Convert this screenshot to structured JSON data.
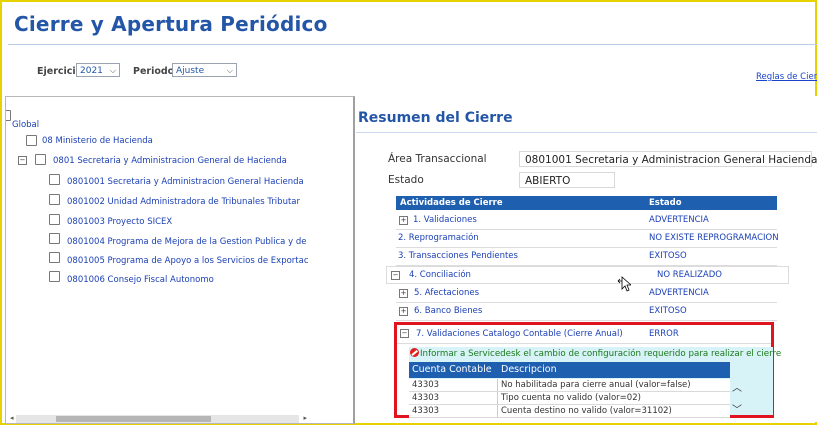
{
  "page": {
    "title": "Cierre y Apertura Periódico"
  },
  "filters": {
    "ejercicio_label": "Ejercicio:",
    "ejercicio_value": "2021",
    "periodo_label": "Periodo:",
    "periodo_value": "Ajuste",
    "reglas_link": "Reglas de Cierre"
  },
  "tree": {
    "root": "Global",
    "items": [
      {
        "label": "08 Ministerio de Hacienda"
      },
      {
        "label": "0801 Secretaria y Administracion General de Hacienda"
      },
      {
        "label": "0801001 Secretaria y Administracion General Hacienda"
      },
      {
        "label": "0801002 Unidad Administradora de Tribunales Tributar"
      },
      {
        "label": "0801003 Proyecto SICEX"
      },
      {
        "label": "0801004 Programa de Mejora de la Gestion Publica y de"
      },
      {
        "label": "0801005 Programa de Apoyo a los Servicios de Exportac"
      },
      {
        "label": "0801006 Consejo Fiscal Autonomo"
      }
    ]
  },
  "summary": {
    "title": "Resumen del Cierre",
    "area_label": "Área Transaccional",
    "area_value": "0801001 Secretaria y Administracion General Hacienda",
    "estado_label": "Estado",
    "estado_value": "ABIERTO"
  },
  "activities": {
    "col_activity": "Actividades de Cierre",
    "col_status": "Estado",
    "rows": [
      {
        "name": "1. Validaciones",
        "status": "ADVERTENCIA"
      },
      {
        "name": "2. Reprogramación",
        "status": "NO EXISTE REPROGRAMACION"
      },
      {
        "name": "3. Transacciones Pendientes",
        "status": "EXITOSO"
      },
      {
        "name": "4. Conciliación",
        "status": "NO REALIZADO"
      },
      {
        "name": "5. Afectaciones",
        "status": "ADVERTENCIA"
      },
      {
        "name": "6. Banco Bienes",
        "status": "EXITOSO"
      },
      {
        "name": "7. Validaciones Catalogo Contable (Cierre Anual)",
        "status": "ERROR"
      }
    ]
  },
  "detail": {
    "message": "Informar a Servicedesk el cambio de configuración requerido para realizar el cierre",
    "col_cuenta": "Cuenta Contable",
    "col_descripcion": "Descripcion",
    "rows": [
      {
        "cuenta": "43303",
        "descripcion": "No habilitada para cierre anual (valor=false)"
      },
      {
        "cuenta": "43303",
        "descripcion": "Tipo cuenta no valido (valor=02)"
      },
      {
        "cuenta": "43303",
        "descripcion": "Cuenta destino no valido (valor=31102)"
      }
    ]
  },
  "colors": {
    "title_blue": "#2456a8",
    "header_blue": "#1f5fb0",
    "link_blue": "#1a3fb5",
    "error_border": "#e0141e",
    "detail_bg": "#d8f3f8",
    "warning_text": "#1a7a1a",
    "frame_yellow": "#e6d200"
  },
  "icons": {
    "expand": "plus-box-icon",
    "collapse": "minus-box-icon",
    "checkbox": "checkbox-icon",
    "error": "no-entry-icon",
    "cursor": "move-cursor-icon"
  }
}
